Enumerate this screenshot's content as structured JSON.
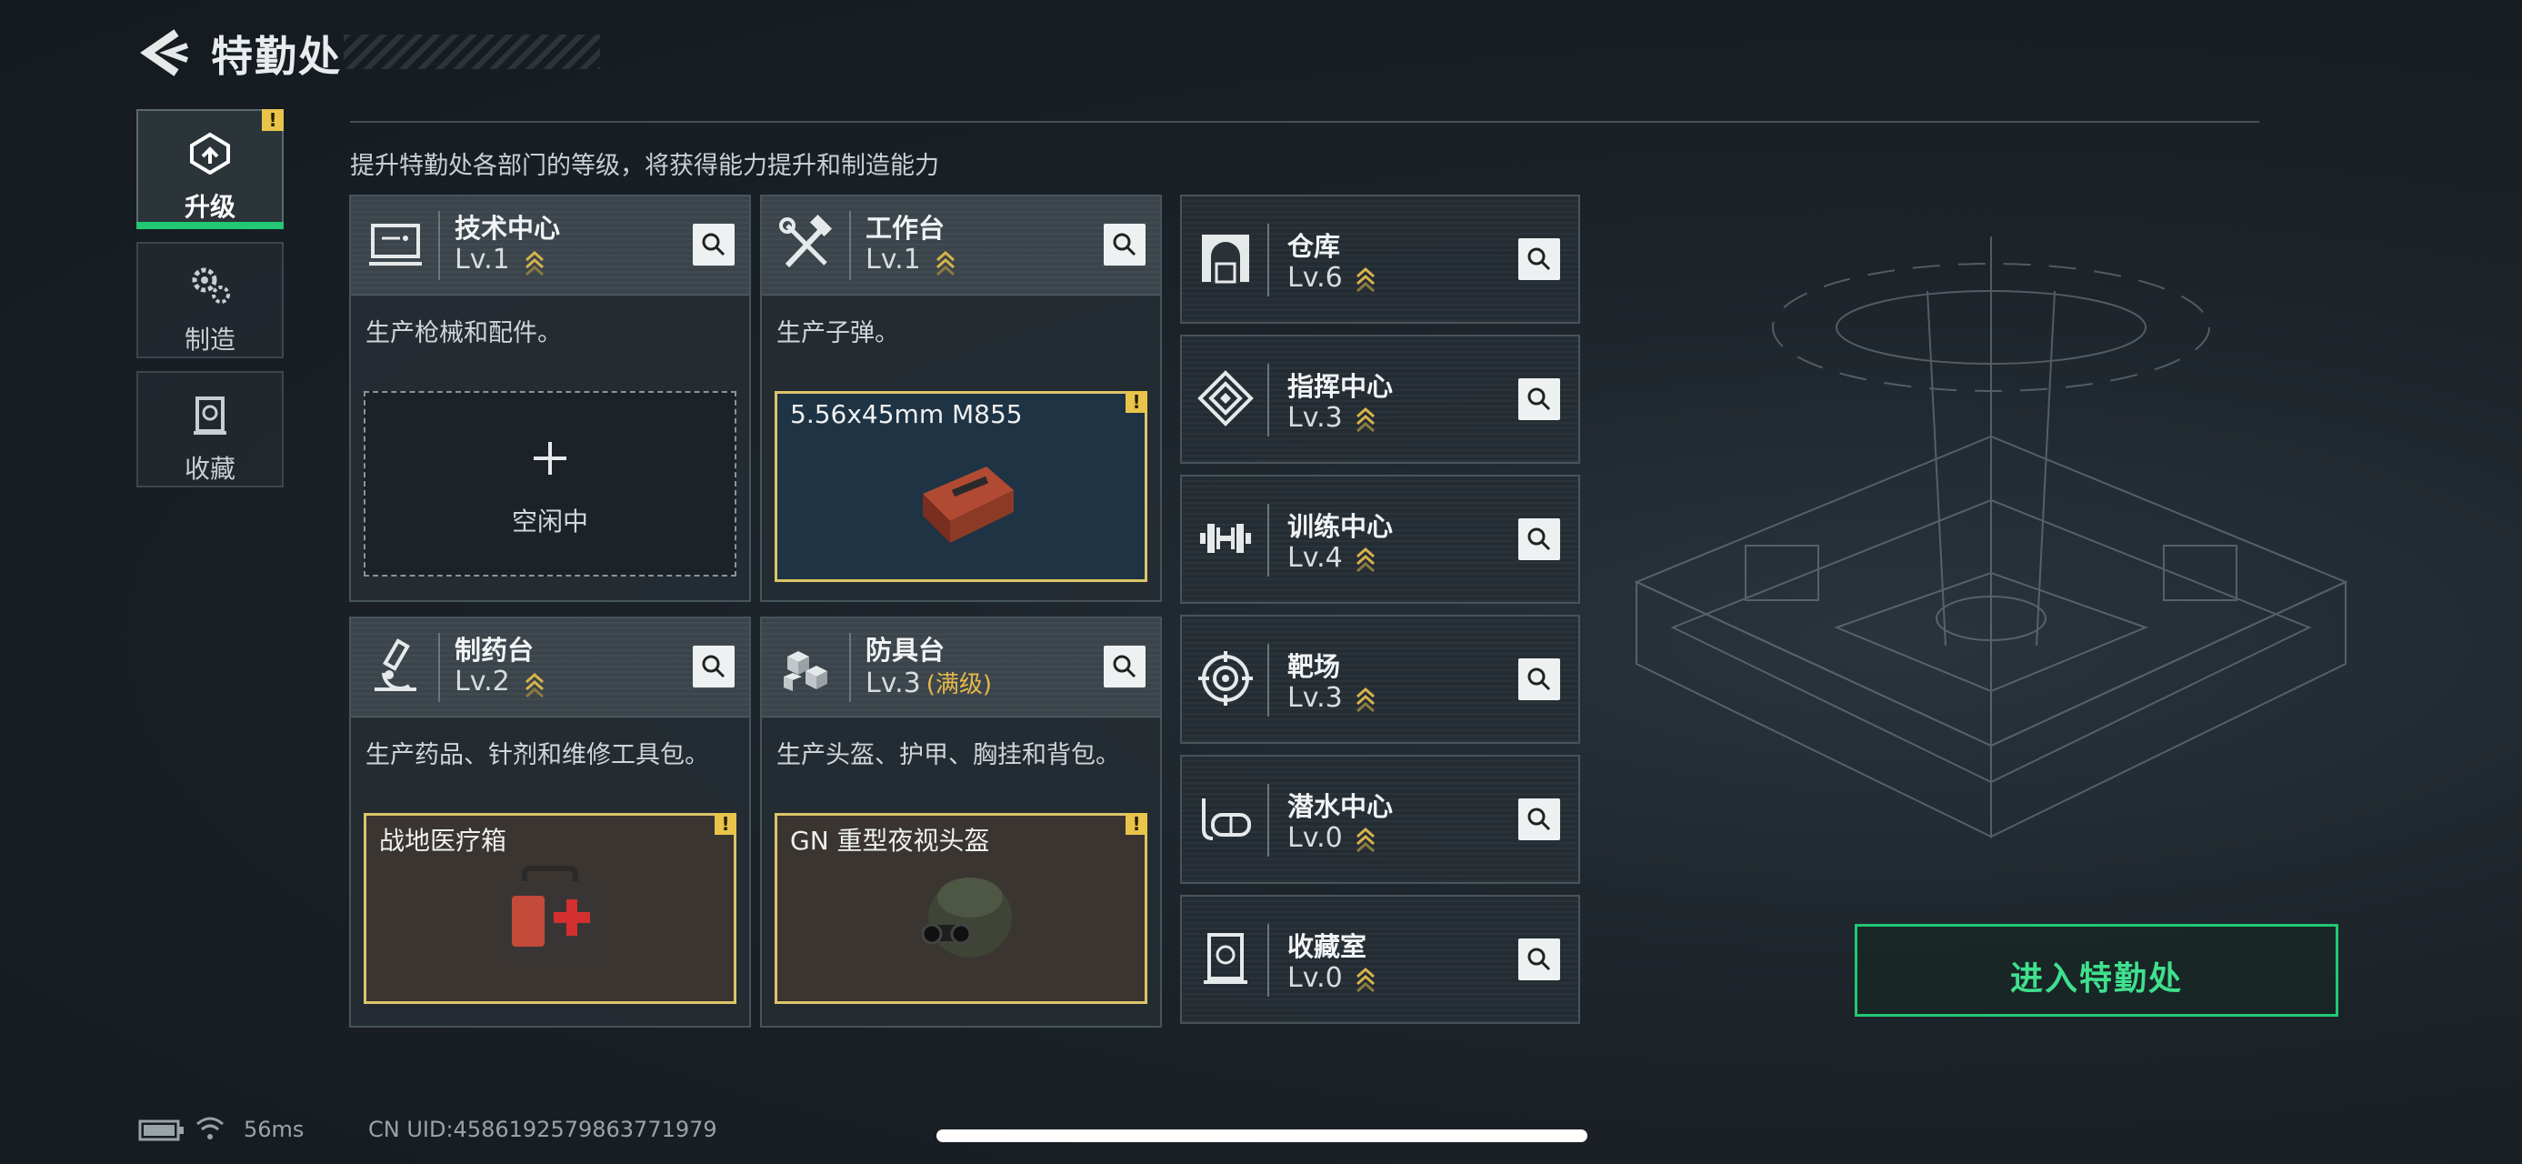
{
  "header": {
    "title": "特勤处"
  },
  "nav": {
    "tabs": [
      {
        "label": "升级",
        "icon": "upgrade-icon",
        "active": true,
        "badge": "!"
      },
      {
        "label": "制造",
        "icon": "gears-icon",
        "active": false
      },
      {
        "label": "收藏",
        "icon": "collection-icon",
        "active": false
      }
    ]
  },
  "subtitle": "提升特勤处各部门的等级，将获得能力提升和制造能力",
  "cards": [
    {
      "name": "技术中心",
      "level": "Lv.1",
      "icon": "monitor-icon",
      "desc": "生产枪械和配件。",
      "slot": {
        "type": "empty",
        "label": "空闲中"
      }
    },
    {
      "name": "工作台",
      "level": "Lv.1",
      "icon": "tools-icon",
      "desc": "生产子弹。",
      "slot": {
        "type": "item",
        "label": "5.56x45mm M855",
        "badge": "!"
      }
    },
    {
      "name": "制药台",
      "level": "Lv.2",
      "icon": "microscope-icon",
      "desc": "生产药品、针剂和维修工具包。",
      "slot": {
        "type": "item",
        "label": "战地医疗箱",
        "badge": "!"
      }
    },
    {
      "name": "防具台",
      "level": "Lv.3",
      "max_tag": "(满级)",
      "icon": "boxes-icon",
      "desc": "生产头盔、护甲、胸挂和背包。",
      "slot": {
        "type": "item",
        "label": "GN 重型夜视头盔",
        "badge": "!"
      }
    }
  ],
  "facilities": [
    {
      "name": "仓库",
      "level": "Lv.6",
      "icon": "warehouse-icon"
    },
    {
      "name": "指挥中心",
      "level": "Lv.3",
      "icon": "command-icon"
    },
    {
      "name": "训练中心",
      "level": "Lv.4",
      "icon": "dumbbell-icon"
    },
    {
      "name": "靶场",
      "level": "Lv.3",
      "icon": "target-icon"
    },
    {
      "name": "潜水中心",
      "level": "Lv.0",
      "icon": "diving-mask-icon"
    },
    {
      "name": "收藏室",
      "level": "Lv.0",
      "icon": "collection-icon"
    }
  ],
  "enter_button": "进入特勤处",
  "status": {
    "ping": "56ms",
    "uid": "CN UID:4586192579863771979"
  },
  "colors": {
    "accent_green": "#22c874",
    "warning_yellow": "#e8c44a",
    "chevron_gold": "#d6b44a"
  }
}
